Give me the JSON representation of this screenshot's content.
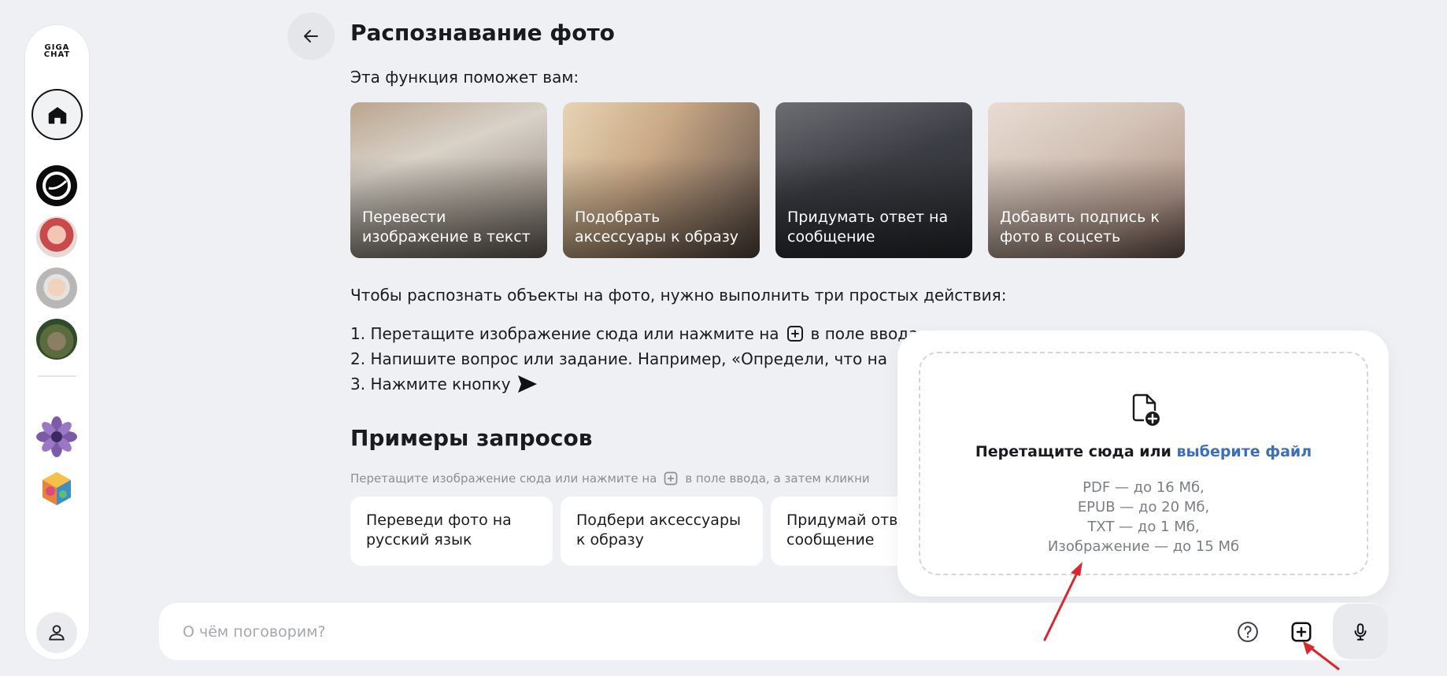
{
  "sidebar": {
    "logo_line1": "GIGA",
    "logo_line2": "CHAT",
    "items": [
      {
        "name": "home"
      },
      {
        "name": "bot-1"
      },
      {
        "name": "bot-2"
      },
      {
        "name": "bot-3"
      },
      {
        "name": "bot-4"
      },
      {
        "name": "bot-5"
      },
      {
        "name": "bot-6"
      }
    ]
  },
  "header": {
    "title": "Распознавание фото"
  },
  "main": {
    "intro": "Эта функция поможет вам:",
    "cards": [
      {
        "label": "Перевести изображение в текст"
      },
      {
        "label": "Подобрать аксессуары к образу"
      },
      {
        "label": "Придумать ответ на сообщение"
      },
      {
        "label": "Добавить подпись к фото в соцсеть"
      }
    ],
    "steps_intro": "Чтобы распознать объекты на фото, нужно выполнить три простых действия:",
    "step1_before": "1. Перетащите изображение сюда или нажмите на",
    "step1_after": "в поле ввода",
    "step2": "2. Напишите вопрос или задание. Например, «Определи, что на",
    "step3": "3. Нажмите кнопку",
    "examples_title": "Примеры запросов",
    "hint_before": "Перетащите изображение сюда или нажмите на",
    "hint_after": "в поле ввода, а затем кликни",
    "examples": [
      {
        "label": "Переведи фото на русский язык"
      },
      {
        "label": "Подбери аксессуары к образу"
      },
      {
        "label": "Придумай отв на сообщение"
      }
    ]
  },
  "dropzone": {
    "prompt": "Перетащите сюда или",
    "link": "выберите файл",
    "limits": [
      "PDF — до 16 Мб,",
      "EPUB — до 20 Мб,",
      "TXT — до 1 Мб,",
      "Изображение — до 15 Мб"
    ]
  },
  "input": {
    "placeholder": "О чём поговорим?"
  },
  "colors": {
    "accent_link": "#3d6fb8",
    "annotation_arrow": "#d9272e",
    "background": "#eef0f3"
  }
}
